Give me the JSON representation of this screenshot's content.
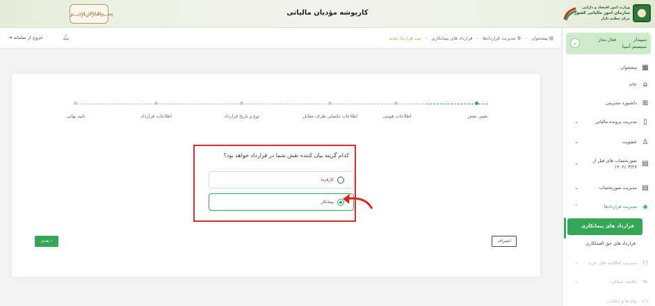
{
  "header": {
    "title": "کارپوشه مؤدیان مالیاتی",
    "org_line1": "وزارت امور اقتصاد و دارایی",
    "org_line2": "سازمان امور مالیاتی کشور",
    "org_line3": "مرکز تنظیم بازار"
  },
  "user": {
    "name": "سپیدار سیستم آسیا",
    "status": "فعال مجاز"
  },
  "sidebar": {
    "items": [
      {
        "label": "پیشخوان",
        "icon": "dashboard-icon"
      },
      {
        "label": "خانه",
        "icon": "home-icon"
      },
      {
        "label": "داشبورد مدیریتی",
        "icon": "grid-icon"
      },
      {
        "label": "مدیریت پرونده مالیاتی",
        "icon": "file-icon"
      },
      {
        "label": "عضویت",
        "icon": "user-icon"
      },
      {
        "label": "صورتحساب های قبل از ۱۴۰۲/۰۳/۲۷",
        "icon": "invoice-icon"
      },
      {
        "label": "مدیریت صورتحساب",
        "icon": "invoice-icon"
      },
      {
        "label": "مدیریت قراردادها",
        "icon": "contract-icon"
      },
      {
        "label": "مدیریت اطلاعیه های خرید",
        "icon": "bag-icon"
      },
      {
        "label": "خلاصه عملکرد",
        "icon": "chart-icon"
      },
      {
        "label": "پیام ها و اعلانات",
        "icon": "message-icon"
      }
    ],
    "sub_active": "قرارداد های پیمانکاری",
    "sub_item": "قرارداد های حق العملکاری",
    "colors": {
      "accent": "#35a655",
      "highlight": "#cdeac9"
    }
  },
  "breadcrumb": {
    "items": [
      "پیشخوان",
      "مدیریت قراردادها",
      "قرارداد های پیمانکاری",
      "ثبت قرارداد جدید"
    ],
    "logout": "خروج از سامانه"
  },
  "steps": [
    {
      "label": "تعیین نقش",
      "active": true
    },
    {
      "label": "اطلاعات هویتی",
      "active": false
    },
    {
      "label": "اطلاعات تکمیلی طرف مقابل",
      "active": false
    },
    {
      "label": "نوع و تاریخ قرارداد",
      "active": false
    },
    {
      "label": "اطلاعات قرارداد",
      "active": false
    },
    {
      "label": "تایید نهایی",
      "active": false
    }
  ],
  "form": {
    "question": "کدام گزینه بیان کننده نقش شما در قرارداد خواهد بود؟",
    "options": [
      {
        "label": "کارفرما",
        "selected": false
      },
      {
        "label": "پیمانکار",
        "selected": true
      }
    ],
    "next_label": "بعدی",
    "cancel_label": "انصراف"
  }
}
